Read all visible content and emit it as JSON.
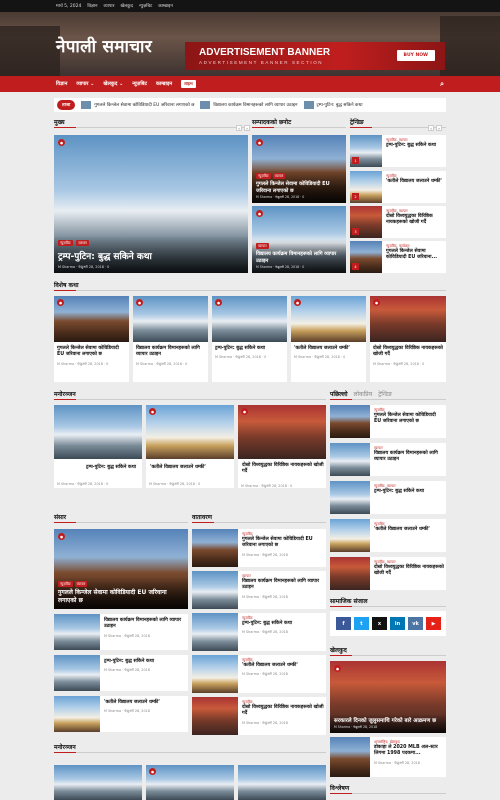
{
  "topbar": {
    "date": "मार्च 5, 2024",
    "links": [
      "विज्ञान",
      "व्यापार",
      "खेलकुद",
      "न्युज़बिट",
      "काम्ब्राइन"
    ]
  },
  "header": {
    "site_title": "नेपाली समाचार",
    "ad_title": "ADVERTISEMENT BANNER",
    "ad_subtitle": "ADVERTISEMENT BANNER SECTION",
    "ad_button": "BUY NOW"
  },
  "nav": {
    "items": [
      "विज्ञान",
      "व्यापार ⌄",
      "खेलकुद ⌄",
      "न्युज़बिट",
      "काम्ब्राइन"
    ],
    "live_badge": "लाइभ",
    "search_icon": "search-icon"
  },
  "ticker": {
    "label": "ताजा",
    "items": [
      "गुगलले किन्जेल सेवामा कोविडियादी EU जरिवाना लगाएको छ",
      "विद्यालय कार्यक्रम विमानहरूको लागि व्यापार उठाइन",
      "ट्रम्प-पुटिन: बुद्ध सकिने कथा"
    ]
  },
  "sections": {
    "main": "मुख्य",
    "recommended": "सम्पादकको छनोट",
    "trending": "ट्रेन्डिङ",
    "special": "विशेष कथा",
    "entertainment": "मनोरञ्जन",
    "world": "संसार",
    "environment": "वातावरण",
    "sidebar_tabs": [
      "पछिल्लो",
      "लोकप्रिय",
      "ट्रेन्डिङ"
    ],
    "social": "सामाजिक संजाल",
    "sports": "खेलकुद",
    "entertainment2": "मनोरञ्जन",
    "analysis": "विश्लेषण"
  },
  "featured": {
    "tags": [
      "न्युज़बिट",
      "व्यापार"
    ],
    "title": "ट्रम्प-पुटिन: बुद्ध सकिने कथा",
    "author": "M Sharma",
    "date": "फेब्रुअरी 28, 2018",
    "comments": "0"
  },
  "editors": [
    {
      "tags": [
        "न्युज़बिट",
        "व्यापार"
      ],
      "title": "गुगलले किन्जेल सेवामा कोविडियादी EU जरिवाना लगाएको छ",
      "author": "M Sharma",
      "date": "फेब्रुअरी 28, 2018",
      "comments": "0"
    },
    {
      "tags": [
        "व्यापार"
      ],
      "title": "विद्यालय कार्यक्रम विमानहरूको लागि व्यापार उठाइन",
      "author": "M Sharma",
      "date": "फेब्रुअरी 28, 2018",
      "comments": "0"
    }
  ],
  "trending": [
    {
      "cat": "न्युज़बिट, व्यापार",
      "title": "ट्रम्प-पुटिन: बुद्ध सकिने कथा",
      "num": "1"
    },
    {
      "cat": "न्युज़बिट",
      "title": "'कतीले विद्यालय जलाउने धम्की'",
      "num": "2"
    },
    {
      "cat": "न्युज़बिट, व्यापार",
      "title": "दोस्रो विश्वयुद्धका विरिष्ठिक नायकहरूको खोजी गर्दै",
      "num": "3"
    },
    {
      "cat": "न्युज़बिट, कार्यक्रम",
      "title": "गुगलले किन्जेल सेवामा कोविडियादी EU जरिवाना...",
      "num": "4"
    }
  ],
  "special_stories": [
    {
      "title": "गुगलले किन्जेल सेवामा कोविडियादी EU जरिवाना लगाएको छ",
      "author": "M Sharma",
      "date": "फेब्रुअरी 28, 2018",
      "comments": "0"
    },
    {
      "title": "विद्यालय कार्यक्रम विमानहरूको लागि व्यापार उठाइन",
      "author": "M Sharma",
      "date": "फेब्रुअरी 28, 2018",
      "comments": "0"
    },
    {
      "title": "ट्रम्प-पुटिन: बुद्ध सकिने कथा",
      "author": "M Sharma",
      "date": "फेब्रुअरी 28, 2018",
      "comments": "0"
    },
    {
      "title": "'कतीले विद्यालय जलाउने धम्की'",
      "author": "M Sharma",
      "date": "फेब्रुअरी 28, 2018",
      "comments": "0"
    },
    {
      "title": "दोस्रो विश्वयुद्धका विरिष्ठिक नायकहरूको खोजी गर्दै",
      "author": "M Sharma",
      "date": "फेब्रुअरी 28, 2018",
      "comments": "0"
    }
  ],
  "entertainment": [
    {
      "title": "ट्रम्प-पुटिन: बुद्ध सकिने कथा",
      "author": "M Sharma",
      "date": "फेब्रुअरी 28, 2018",
      "comments": "0"
    },
    {
      "title": "'कतीले विद्यालय जलाउने धम्की'",
      "author": "M Sharma",
      "date": "फेब्रुअरी 28, 2018",
      "comments": "0"
    },
    {
      "title": "दोस्रो विश्वयुद्धका विरिष्ठिक नायकहरूको खोजी गर्दै",
      "author": "M Sharma",
      "date": "फेब्रुअरी 28, 2018",
      "comments": "0"
    }
  ],
  "latest": [
    {
      "cat": "न्युज़बिट",
      "title": "गुगलले किन्जेल सेवामा कोविडियादी EU जरिवाना लगाएको छ"
    },
    {
      "cat": "व्यापार",
      "title": "विद्यालय कार्यक्रम विमानहरूको लागि व्यापार उठाइन"
    },
    {
      "cat": "न्युज़बिट, व्यापार",
      "title": "ट्रम्प-पुटिन: बुद्ध सकिने कथा"
    },
    {
      "cat": "न्युज़बिट",
      "title": "'कतीले विद्यालय जलाउने धम्की'"
    },
    {
      "cat": "न्युज़बिट, व्यापार",
      "title": "दोस्रो विश्वयुद्धका विरिष्ठिक नायकहरूको खोजी गर्दै"
    }
  ],
  "world_main": {
    "tags": [
      "न्युज़बिट",
      "व्यापार"
    ],
    "title": "गुगलले किन्जेल सेवामा कोविडियादी EU जरिवाना लगाएको छ"
  },
  "world_list": [
    {
      "title": "विद्यालय कार्यक्रम विमानहरूको लागि व्यापार उठाइन",
      "meta": "M Sharma · फेब्रुअरी 28, 2018"
    },
    {
      "title": "ट्रम्प-पुटिन: बुद्ध सकिने कथा",
      "meta": "M Sharma · फेब्रुअरी 28, 2018"
    },
    {
      "title": "'कतीले विद्यालय जलाउने धम्की'",
      "meta": "M Sharma · फेब्रुअरी 28, 2018"
    }
  ],
  "env_list": [
    {
      "cat": "न्युज़बिट",
      "title": "गुगलले किन्जेल सेवामा कोविडियादी EU जरिवाना लगाएको छ",
      "meta": "M Sharma · फेब्रुअरी 28, 2018"
    },
    {
      "cat": "व्यापार",
      "title": "विद्यालय कार्यक्रम विमानहरूको लागि व्यापार उठाइन",
      "meta": "M Sharma · फेब्रुअरी 28, 2018"
    },
    {
      "cat": "न्युज़बिट",
      "title": "ट्रम्प-पुटिन: बुद्ध सकिने कथा",
      "meta": "M Sharma · फेब्रुअरी 28, 2018"
    },
    {
      "cat": "न्युज़बिट",
      "title": "'कतीले विद्यालय जलाउने धम्की'",
      "meta": "M Sharma · फेब्रुअरी 28, 2018"
    },
    {
      "cat": "न्युज़बिट",
      "title": "दोस्रो विश्वयुद्धका विरिष्ठिक नायकहरूको खोजी गर्दै",
      "meta": "M Sharma · फेब्रुअरी 28, 2018"
    }
  ],
  "social": [
    {
      "name": "facebook-icon",
      "glyph": "f",
      "color": "#3b5998"
    },
    {
      "name": "twitter-icon",
      "glyph": "t",
      "color": "#1da1f2"
    },
    {
      "name": "x-icon",
      "glyph": "x",
      "color": "#111111"
    },
    {
      "name": "linkedin-icon",
      "glyph": "in",
      "color": "#0077b5"
    },
    {
      "name": "vk-icon",
      "glyph": "vk",
      "color": "#4c75a3"
    },
    {
      "name": "youtube-icon",
      "glyph": "▶",
      "color": "#e62117"
    }
  ],
  "sports_main": {
    "title": "सरकारले दिनको जुलुसमाथि गरेको बारे आक्रमण छ",
    "meta": "M Sharma · फेब्रुअरी 28, 2018"
  },
  "sports_small": {
    "cat": "अन्तर्राष्ट्रिय, खेलकुद",
    "title": "डोकाहा ले 2020 MLB अल-स्टार लिगमा 1998 पदकमा...",
    "meta": "M Sharma · फेब्रुअरी 28, 2018"
  },
  "colors": {
    "accent": "#c01e1e",
    "bg": "#ececec"
  }
}
